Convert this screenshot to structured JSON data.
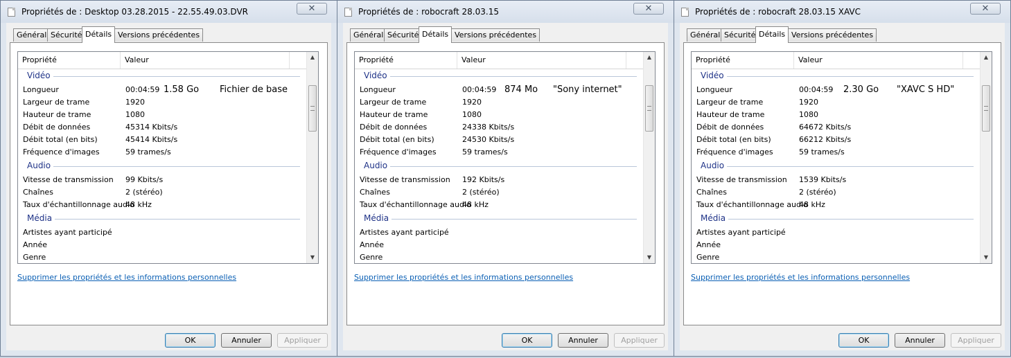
{
  "tabs": [
    "Général",
    "Sécurité",
    "Détails",
    "Versions précédentes"
  ],
  "columns": {
    "property": "Propriété",
    "value": "Valeur"
  },
  "link_text": "Supprimer les propriétés et les informations personnelles",
  "buttons": {
    "ok": "OK",
    "cancel": "Annuler",
    "apply": "Appliquer"
  },
  "close_glyph": "✕",
  "labels": {
    "video": "Vidéo",
    "audio": "Audio",
    "media": "Média",
    "length": "Longueur",
    "frame_width": "Largeur de trame",
    "frame_height": "Hauteur de trame",
    "data_rate": "Débit de données",
    "total_bitrate": "Débit total (en bits)",
    "frame_rate": "Fréquence d'images",
    "bitrate": "Vitesse de transmission",
    "channels": "Chaînes",
    "sample_rate": "Taux d'échantillonnage audio",
    "artists": "Artistes ayant participé",
    "year": "Année",
    "genre": "Genre"
  },
  "dialogs": [
    {
      "title": "Propriétés de : Desktop 03.28.2015 - 22.55.49.03.DVR",
      "length": "00:04:59",
      "size_note": "1.58 Go",
      "note": "Fichier de base",
      "frame_width": "1920",
      "frame_height": "1080",
      "data_rate": "45314 Kbits/s",
      "total_bitrate": "45414 Kbits/s",
      "frame_rate": "59 trames/s",
      "audio_bitrate": "99 Kbits/s",
      "channels": "2 (stéréo)",
      "sample_rate": "48 kHz"
    },
    {
      "title": "Propriétés de : robocraft 28.03.15",
      "length": "00:04:59",
      "size_note": "874 Mo",
      "note": "\"Sony internet\"",
      "frame_width": "1920",
      "frame_height": "1080",
      "data_rate": "24338 Kbits/s",
      "total_bitrate": "24530 Kbits/s",
      "frame_rate": "59 trames/s",
      "audio_bitrate": "192 Kbits/s",
      "channels": "2 (stéréo)",
      "sample_rate": "48 kHz"
    },
    {
      "title": "Propriétés de : robocraft 28.03.15 XAVC",
      "length": "00:04:59",
      "size_note": "2.30 Go",
      "note": "\"XAVC S HD\"",
      "frame_width": "1920",
      "frame_height": "1080",
      "data_rate": "64672 Kbits/s",
      "total_bitrate": "66212 Kbits/s",
      "frame_rate": "59 trames/s",
      "audio_bitrate": "1539 Kbits/s",
      "channels": "2 (stéréo)",
      "sample_rate": "48 kHz"
    }
  ]
}
